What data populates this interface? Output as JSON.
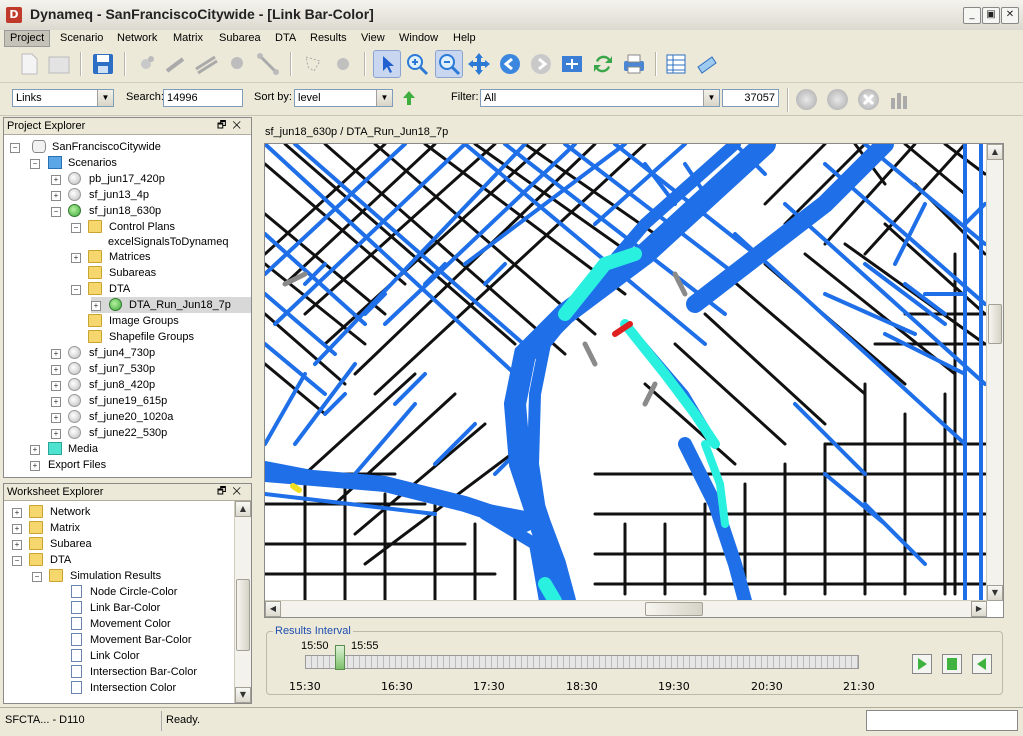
{
  "window": {
    "title": "Dynameq - SanFranciscoCitywide - [Link Bar-Color]",
    "app_letter": "D"
  },
  "menu": [
    "Project",
    "Scenario",
    "Network",
    "Matrix",
    "Subarea",
    "DTA",
    "Results",
    "View",
    "Window",
    "Help"
  ],
  "toolbar2": {
    "type_value": "Links",
    "search_label": "Search:",
    "search_value": "14996",
    "sortby_label": "Sort by:",
    "sortby_value": "level",
    "filter_label": "Filter:",
    "filter_value": "All",
    "count": "37057"
  },
  "project_explorer": {
    "title": "Project Explorer",
    "nodes": [
      {
        "label": "SanFranciscoCitywide",
        "icon": "database-icon"
      },
      {
        "label": "Scenarios",
        "icon": "folder-icon"
      },
      {
        "label": "pb_jun17_420p",
        "icon": "scenario-icon"
      },
      {
        "label": "sf_jun13_4p",
        "icon": "scenario-icon"
      },
      {
        "label": "sf_jun18_630p",
        "icon": "scenario-active-icon"
      },
      {
        "label": "Control Plans",
        "icon": "folder-icon"
      },
      {
        "label": "excelSignalsToDynameq",
        "icon": "none"
      },
      {
        "label": "Matrices",
        "icon": "folder-icon"
      },
      {
        "label": "Subareas",
        "icon": "folder-icon"
      },
      {
        "label": "DTA",
        "icon": "folder-icon"
      },
      {
        "label": "DTA_Run_Jun18_7p",
        "icon": "run-icon"
      },
      {
        "label": "Image Groups",
        "icon": "folder-icon"
      },
      {
        "label": "Shapefile Groups",
        "icon": "folder-icon"
      },
      {
        "label": "sf_jun4_730p",
        "icon": "scenario-icon"
      },
      {
        "label": "sf_jun7_530p",
        "icon": "scenario-icon"
      },
      {
        "label": "sf_jun8_420p",
        "icon": "scenario-icon"
      },
      {
        "label": "sf_june19_615p",
        "icon": "scenario-icon"
      },
      {
        "label": "sf_june20_1020a",
        "icon": "scenario-icon"
      },
      {
        "label": "sf_june22_530p",
        "icon": "scenario-icon"
      },
      {
        "label": "Media",
        "icon": "media-icon"
      },
      {
        "label": "Export Files",
        "icon": "none"
      }
    ]
  },
  "worksheet_explorer": {
    "title": "Worksheet Explorer",
    "nodes": [
      {
        "label": "Network"
      },
      {
        "label": "Matrix"
      },
      {
        "label": "Subarea"
      },
      {
        "label": "DTA"
      },
      {
        "label": "Simulation Results"
      },
      {
        "label": "Node Circle-Color"
      },
      {
        "label": "Link Bar-Color"
      },
      {
        "label": "Movement Color"
      },
      {
        "label": "Movement Bar-Color"
      },
      {
        "label": "Link Color"
      },
      {
        "label": "Intersection Bar-Color"
      },
      {
        "label": "Intersection Color"
      }
    ]
  },
  "map": {
    "breadcrumb": "sf_jun18_630p / DTA_Run_Jun18_7p"
  },
  "results_interval": {
    "title": "Results Interval",
    "start_marker": "15:50",
    "end_marker": "15:55",
    "ticks": [
      "15:30",
      "16:30",
      "17:30",
      "18:30",
      "19:30",
      "20:30",
      "21:30"
    ]
  },
  "status": {
    "left": "SFCTA... - D110",
    "message": "Ready."
  },
  "colors": {
    "accent": "#1f6fe0",
    "link_blue": "#1e6fe8",
    "link_black": "#111111",
    "cyan": "#2af0e0"
  }
}
